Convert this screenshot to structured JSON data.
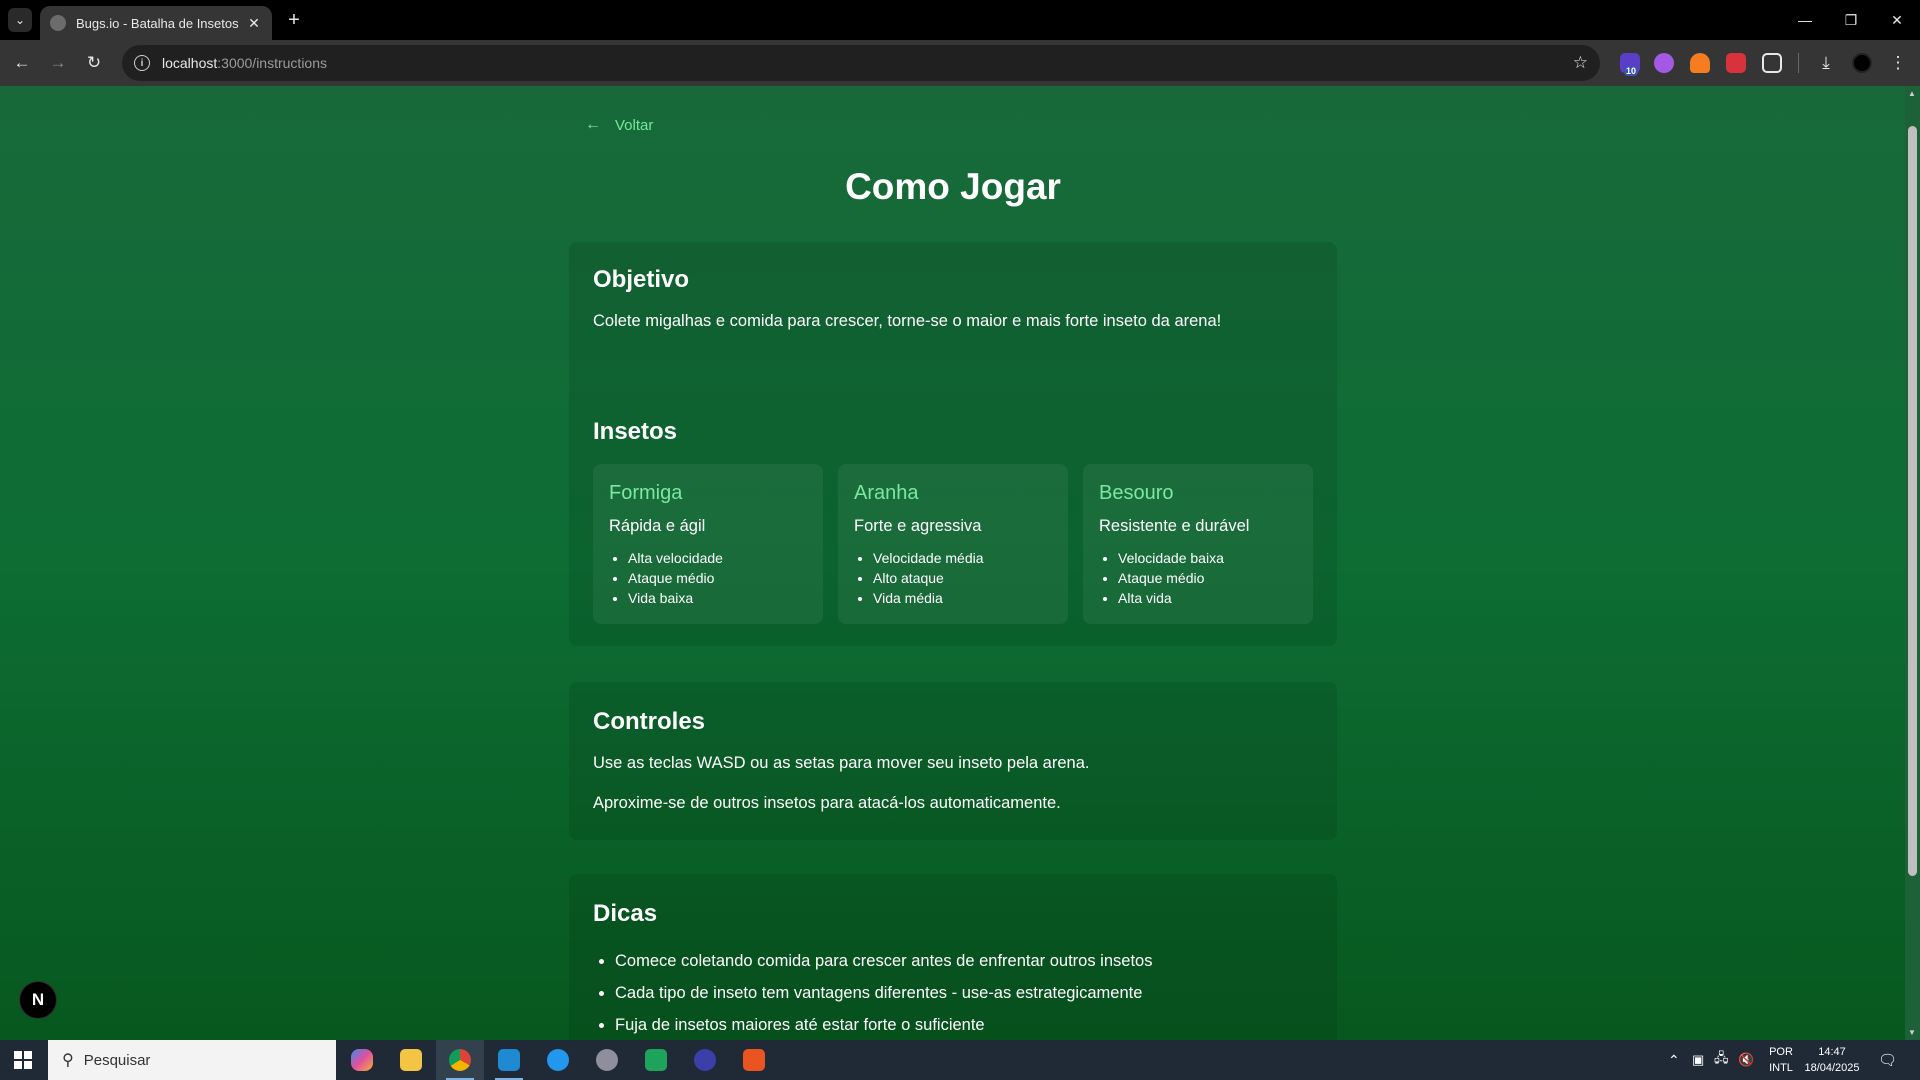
{
  "browser": {
    "tab_title": "Bugs.io - Batalha de Insetos",
    "url_host": "localhost",
    "url_path": ":3000/instructions",
    "extension_badge": "10"
  },
  "page": {
    "back_label": "Voltar",
    "title": "Como Jogar",
    "objective": {
      "heading": "Objetivo",
      "text": "Colete migalhas e comida para crescer, torne-se o maior e mais forte inseto da arena!"
    },
    "insects": {
      "heading": "Insetos",
      "items": [
        {
          "name": "Formiga",
          "description": "Rápida e ágil",
          "traits": [
            "Alta velocidade",
            "Ataque médio",
            "Vida baixa"
          ]
        },
        {
          "name": "Aranha",
          "description": "Forte e agressiva",
          "traits": [
            "Velocidade média",
            "Alto ataque",
            "Vida média"
          ]
        },
        {
          "name": "Besouro",
          "description": "Resistente e durável",
          "traits": [
            "Velocidade baixa",
            "Ataque médio",
            "Alta vida"
          ]
        }
      ]
    },
    "controls": {
      "heading": "Controles",
      "lines": [
        "Use as teclas WASD ou as setas para mover seu inseto pela arena.",
        "Aproxime-se de outros insetos para atacá-los automaticamente."
      ]
    },
    "tips": {
      "heading": "Dicas",
      "items": [
        "Comece coletando comida para crescer antes de enfrentar outros insetos",
        "Cada tipo de inseto tem vantagens diferentes - use-as estrategicamente",
        "Fuja de insetos maiores até estar forte o suficiente"
      ]
    },
    "dev_badge": "N"
  },
  "taskbar": {
    "search_placeholder": "Pesquisar",
    "language": "POR",
    "layout": "INTL",
    "time": "14:47",
    "date": "18/04/2025"
  }
}
